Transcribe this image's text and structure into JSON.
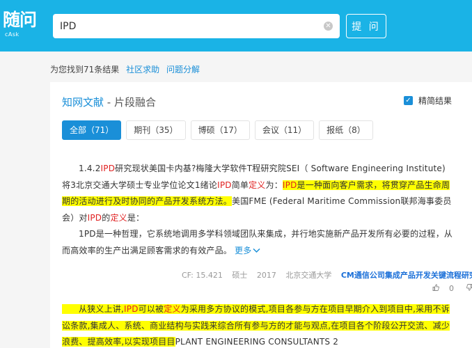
{
  "logo": {
    "main": "随问",
    "sub": "cAsk"
  },
  "search": {
    "value": "IPD",
    "button_label": "提 问"
  },
  "results": {
    "summary": "为您找到71条结果",
    "community_help": "社区求助",
    "problem_decompose": "问题分解"
  },
  "card": {
    "title": "知网文献",
    "subtitle": " - 片段融合",
    "concise_label": "精简结果",
    "tabs": [
      {
        "label": "全部（71）",
        "active": true
      },
      {
        "label": "期刊（35）"
      },
      {
        "label": "博硕（17）"
      },
      {
        "label": "会议（11）"
      },
      {
        "label": "报纸（8）"
      }
    ],
    "result1": {
      "t1": "1.4.2",
      "t2": "IPD",
      "t3": "研究现状美国卡内基?梅隆大学软件T程研究院SEI（ Software Engineering Institute)将3北京交通大学硕士专业学位论文1绪论",
      "t4": "IPD",
      "t5": "简单",
      "t6": "定义",
      "t7": "为：",
      "t8": "IPD",
      "t9": "是一种面向客户需求，将贯穿产品生命周期的活动进行及时协同的产品开发系统方法。",
      "t10": "美国FME (Federal Maritime Commission联邦海事委员会）对",
      "t11": "IPD",
      "t12": "的",
      "t13": "定义",
      "t14": "是：",
      "t15": "1PD是一种哲理，它系统地调用多学科领域团队来集成，并行地实施新产品开发所有必要的过程，从而高效率的生产出满足顾客需求的有效产品。",
      "more": "更多"
    },
    "meta": {
      "cf": "CF: 15.421",
      "degree": "硕士",
      "year": "2017",
      "school": "北京交通大学",
      "doc_title": "CM通信公司集成产品开发关键流程研究"
    },
    "votes": {
      "up": "0",
      "down": "0"
    },
    "result2": {
      "t1": "从狭义上讲,",
      "t2": "IPD",
      "t3": "可以被",
      "t4": "定义",
      "t5": "为采用多方协议的模式,项目各参与方在项目早期介入到项目中,采用不诉讼条款,集成人、系统、商业结构与实践来综合所有参与方的才能与观点,在项目各个阶段公开交流、减少浪费、提高效率,以实现项目目",
      "t6": "PLANT ENGINEERING CONSULTANTS 2"
    }
  },
  "colors": {
    "topbar": "#1ab3e6",
    "link": "#1a8fd8",
    "keyword": "#e02020",
    "highlight": "#ffff00"
  },
  "icons": [
    "clear-icon",
    "checkbox-checked-icon",
    "chevron-down-icon",
    "thumbs-up-icon",
    "thumbs-down-icon"
  ]
}
